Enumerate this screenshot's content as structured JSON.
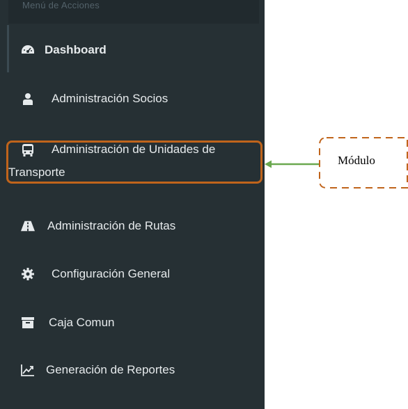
{
  "sidebar": {
    "header": "Menú de Acciones",
    "items": [
      {
        "icon": "dashboard-icon",
        "label": "Dashboard"
      },
      {
        "icon": "user-icon",
        "label": "Administración Socios"
      },
      {
        "icon": "bus-icon",
        "label": "Administración de Unidades de",
        "label_line2": "Transporte"
      },
      {
        "icon": "road-icon",
        "label": "Administración de Rutas"
      },
      {
        "icon": "gear-icon",
        "label": "Configuración General"
      },
      {
        "icon": "archive-icon",
        "label": "Caja Comun"
      },
      {
        "icon": "line-chart-icon",
        "label": "Generación de Reportes"
      }
    ]
  },
  "annotation": {
    "label": "Módulo",
    "highlight_color": "#c0641b",
    "arrow_color": "#6aa84f"
  },
  "colors": {
    "sidebar_bg": "#263034",
    "text": "#e6eaec"
  }
}
